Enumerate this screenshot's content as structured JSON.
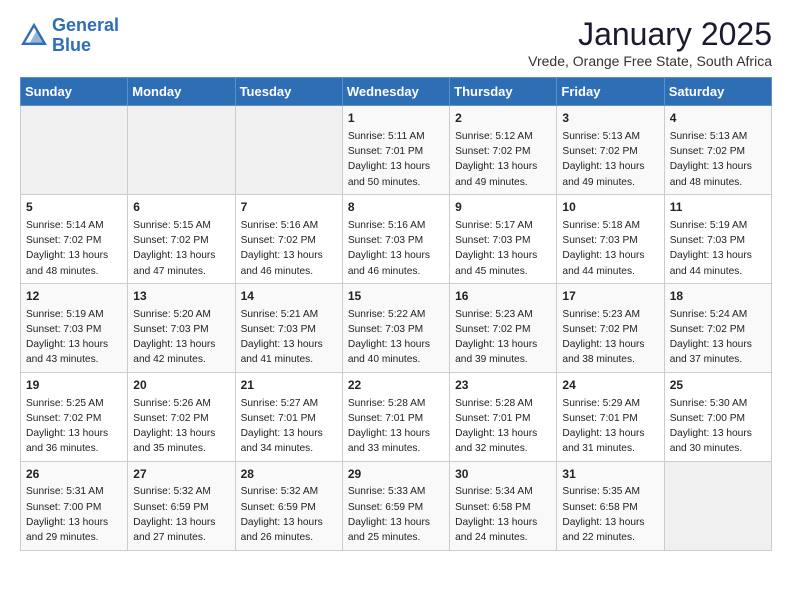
{
  "logo": {
    "line1": "General",
    "line2": "Blue"
  },
  "title": "January 2025",
  "subtitle": "Vrede, Orange Free State, South Africa",
  "weekdays": [
    "Sunday",
    "Monday",
    "Tuesday",
    "Wednesday",
    "Thursday",
    "Friday",
    "Saturday"
  ],
  "weeks": [
    [
      {
        "day": "",
        "sunrise": "",
        "sunset": "",
        "daylight": ""
      },
      {
        "day": "",
        "sunrise": "",
        "sunset": "",
        "daylight": ""
      },
      {
        "day": "",
        "sunrise": "",
        "sunset": "",
        "daylight": ""
      },
      {
        "day": "1",
        "sunrise": "Sunrise: 5:11 AM",
        "sunset": "Sunset: 7:01 PM",
        "daylight": "Daylight: 13 hours and 50 minutes."
      },
      {
        "day": "2",
        "sunrise": "Sunrise: 5:12 AM",
        "sunset": "Sunset: 7:02 PM",
        "daylight": "Daylight: 13 hours and 49 minutes."
      },
      {
        "day": "3",
        "sunrise": "Sunrise: 5:13 AM",
        "sunset": "Sunset: 7:02 PM",
        "daylight": "Daylight: 13 hours and 49 minutes."
      },
      {
        "day": "4",
        "sunrise": "Sunrise: 5:13 AM",
        "sunset": "Sunset: 7:02 PM",
        "daylight": "Daylight: 13 hours and 48 minutes."
      }
    ],
    [
      {
        "day": "5",
        "sunrise": "Sunrise: 5:14 AM",
        "sunset": "Sunset: 7:02 PM",
        "daylight": "Daylight: 13 hours and 48 minutes."
      },
      {
        "day": "6",
        "sunrise": "Sunrise: 5:15 AM",
        "sunset": "Sunset: 7:02 PM",
        "daylight": "Daylight: 13 hours and 47 minutes."
      },
      {
        "day": "7",
        "sunrise": "Sunrise: 5:16 AM",
        "sunset": "Sunset: 7:02 PM",
        "daylight": "Daylight: 13 hours and 46 minutes."
      },
      {
        "day": "8",
        "sunrise": "Sunrise: 5:16 AM",
        "sunset": "Sunset: 7:03 PM",
        "daylight": "Daylight: 13 hours and 46 minutes."
      },
      {
        "day": "9",
        "sunrise": "Sunrise: 5:17 AM",
        "sunset": "Sunset: 7:03 PM",
        "daylight": "Daylight: 13 hours and 45 minutes."
      },
      {
        "day": "10",
        "sunrise": "Sunrise: 5:18 AM",
        "sunset": "Sunset: 7:03 PM",
        "daylight": "Daylight: 13 hours and 44 minutes."
      },
      {
        "day": "11",
        "sunrise": "Sunrise: 5:19 AM",
        "sunset": "Sunset: 7:03 PM",
        "daylight": "Daylight: 13 hours and 44 minutes."
      }
    ],
    [
      {
        "day": "12",
        "sunrise": "Sunrise: 5:19 AM",
        "sunset": "Sunset: 7:03 PM",
        "daylight": "Daylight: 13 hours and 43 minutes."
      },
      {
        "day": "13",
        "sunrise": "Sunrise: 5:20 AM",
        "sunset": "Sunset: 7:03 PM",
        "daylight": "Daylight: 13 hours and 42 minutes."
      },
      {
        "day": "14",
        "sunrise": "Sunrise: 5:21 AM",
        "sunset": "Sunset: 7:03 PM",
        "daylight": "Daylight: 13 hours and 41 minutes."
      },
      {
        "day": "15",
        "sunrise": "Sunrise: 5:22 AM",
        "sunset": "Sunset: 7:03 PM",
        "daylight": "Daylight: 13 hours and 40 minutes."
      },
      {
        "day": "16",
        "sunrise": "Sunrise: 5:23 AM",
        "sunset": "Sunset: 7:02 PM",
        "daylight": "Daylight: 13 hours and 39 minutes."
      },
      {
        "day": "17",
        "sunrise": "Sunrise: 5:23 AM",
        "sunset": "Sunset: 7:02 PM",
        "daylight": "Daylight: 13 hours and 38 minutes."
      },
      {
        "day": "18",
        "sunrise": "Sunrise: 5:24 AM",
        "sunset": "Sunset: 7:02 PM",
        "daylight": "Daylight: 13 hours and 37 minutes."
      }
    ],
    [
      {
        "day": "19",
        "sunrise": "Sunrise: 5:25 AM",
        "sunset": "Sunset: 7:02 PM",
        "daylight": "Daylight: 13 hours and 36 minutes."
      },
      {
        "day": "20",
        "sunrise": "Sunrise: 5:26 AM",
        "sunset": "Sunset: 7:02 PM",
        "daylight": "Daylight: 13 hours and 35 minutes."
      },
      {
        "day": "21",
        "sunrise": "Sunrise: 5:27 AM",
        "sunset": "Sunset: 7:01 PM",
        "daylight": "Daylight: 13 hours and 34 minutes."
      },
      {
        "day": "22",
        "sunrise": "Sunrise: 5:28 AM",
        "sunset": "Sunset: 7:01 PM",
        "daylight": "Daylight: 13 hours and 33 minutes."
      },
      {
        "day": "23",
        "sunrise": "Sunrise: 5:28 AM",
        "sunset": "Sunset: 7:01 PM",
        "daylight": "Daylight: 13 hours and 32 minutes."
      },
      {
        "day": "24",
        "sunrise": "Sunrise: 5:29 AM",
        "sunset": "Sunset: 7:01 PM",
        "daylight": "Daylight: 13 hours and 31 minutes."
      },
      {
        "day": "25",
        "sunrise": "Sunrise: 5:30 AM",
        "sunset": "Sunset: 7:00 PM",
        "daylight": "Daylight: 13 hours and 30 minutes."
      }
    ],
    [
      {
        "day": "26",
        "sunrise": "Sunrise: 5:31 AM",
        "sunset": "Sunset: 7:00 PM",
        "daylight": "Daylight: 13 hours and 29 minutes."
      },
      {
        "day": "27",
        "sunrise": "Sunrise: 5:32 AM",
        "sunset": "Sunset: 6:59 PM",
        "daylight": "Daylight: 13 hours and 27 minutes."
      },
      {
        "day": "28",
        "sunrise": "Sunrise: 5:32 AM",
        "sunset": "Sunset: 6:59 PM",
        "daylight": "Daylight: 13 hours and 26 minutes."
      },
      {
        "day": "29",
        "sunrise": "Sunrise: 5:33 AM",
        "sunset": "Sunset: 6:59 PM",
        "daylight": "Daylight: 13 hours and 25 minutes."
      },
      {
        "day": "30",
        "sunrise": "Sunrise: 5:34 AM",
        "sunset": "Sunset: 6:58 PM",
        "daylight": "Daylight: 13 hours and 24 minutes."
      },
      {
        "day": "31",
        "sunrise": "Sunrise: 5:35 AM",
        "sunset": "Sunset: 6:58 PM",
        "daylight": "Daylight: 13 hours and 22 minutes."
      },
      {
        "day": "",
        "sunrise": "",
        "sunset": "",
        "daylight": ""
      }
    ]
  ]
}
